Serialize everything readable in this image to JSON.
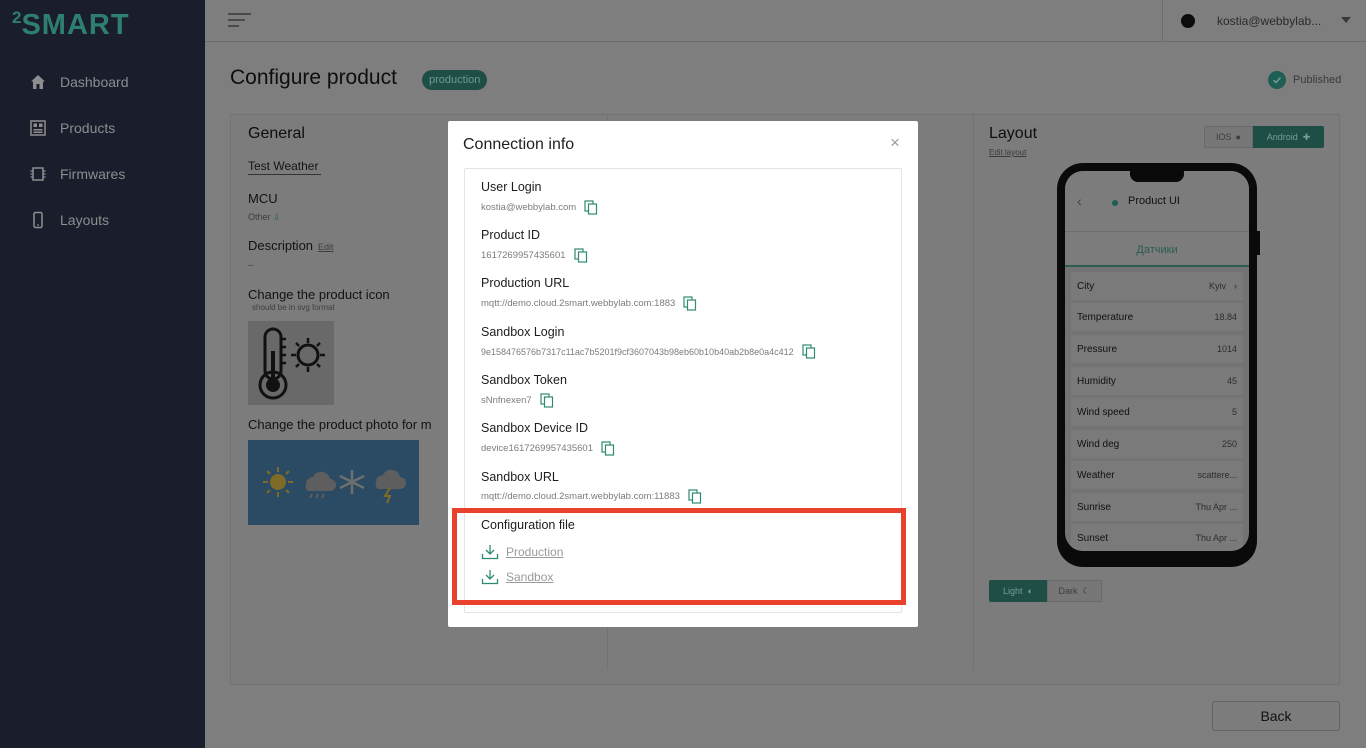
{
  "app": {
    "logo_sup": "2",
    "logo_text": "SMART"
  },
  "sidebar": {
    "items": [
      {
        "label": "Dashboard",
        "icon": "home-icon"
      },
      {
        "label": "Products",
        "icon": "products-icon"
      },
      {
        "label": "Firmwares",
        "icon": "chip-icon"
      },
      {
        "label": "Layouts",
        "icon": "phone-icon"
      }
    ]
  },
  "topbar": {
    "user_email": "kostia@webbylab..."
  },
  "page": {
    "title": "Configure product",
    "env_badge": "production",
    "status": "Published",
    "back_label": "Back"
  },
  "general": {
    "title": "General",
    "product_name": "Test Weather",
    "mcu_label": "MCU",
    "mcu_value": "Other",
    "description_label": "Description",
    "description_edit": "Edit",
    "description_value": "--",
    "icon_label": "Change the product icon",
    "icon_hint": "should be in svg format",
    "photo_label": "Change the product photo for m"
  },
  "layout": {
    "title": "Layout",
    "edit_label": "Edit layout",
    "ios_label": "IOS",
    "android_label": "Android",
    "light_label": "Light",
    "dark_label": "Dark",
    "phone": {
      "title": "Product UI",
      "tab": "Датчики",
      "rows": [
        {
          "k": "City",
          "v": "Kyiv"
        },
        {
          "k": "Temperature",
          "v": "18.84"
        },
        {
          "k": "Pressure",
          "v": "1014"
        },
        {
          "k": "Humidity",
          "v": "45"
        },
        {
          "k": "Wind speed",
          "v": "5"
        },
        {
          "k": "Wind deg",
          "v": "250"
        },
        {
          "k": "Weather",
          "v": "scattere..."
        },
        {
          "k": "Sunrise",
          "v": "Thu Apr ..."
        },
        {
          "k": "Sunset",
          "v": "Thu Apr ..."
        }
      ]
    }
  },
  "modal": {
    "title": "Connection info",
    "close_glyph": "×",
    "fields": [
      {
        "label": "User Login",
        "value": "kostia@webbylab.com"
      },
      {
        "label": "Product ID",
        "value": "1617269957435601"
      },
      {
        "label": "Production URL",
        "value": "mqtt://demo.cloud.2smart.webbylab.com:1883"
      },
      {
        "label": "Sandbox Login",
        "value": "9e158476576b7317c11ac7b5201f9cf3607043b98eb60b10b40ab2b8e0a4c412"
      },
      {
        "label": "Sandbox Token",
        "value": "sNnfnexen7"
      },
      {
        "label": "Sandbox Device ID",
        "value": "device1617269957435601"
      },
      {
        "label": "Sandbox URL",
        "value": "mqtt://demo.cloud.2smart.webbylab.com:11883"
      }
    ],
    "config_label": "Configuration file",
    "downloads": [
      {
        "label": "Production"
      },
      {
        "label": "Sandbox"
      }
    ]
  },
  "colors": {
    "accent": "#1f5e54",
    "highlight": "#e8412c",
    "sidebar_bg": "#1a1e2c",
    "overlay_bg": "#7e7e7e"
  }
}
